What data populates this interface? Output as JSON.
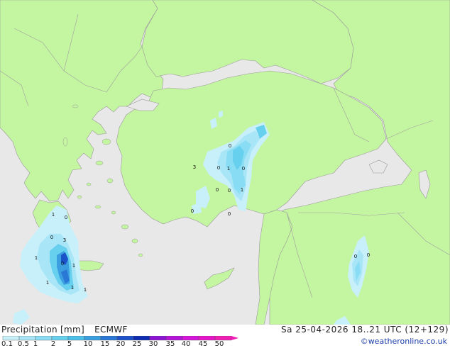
{
  "legend": {
    "title": "Precipitation [mm]",
    "model": "ECMWF",
    "timestamp": "Sa 25-04-2026 18..21 UTC (12+129)",
    "credit": "©weatheronline.co.uk",
    "scale_labels": [
      "0.1",
      "0.5",
      "1",
      "2",
      "5",
      "10",
      "15",
      "20",
      "25",
      "30",
      "35",
      "40",
      "45",
      "50"
    ],
    "scale_colors": [
      "#c8f0fa",
      "#a8e6f7",
      "#88dcf3",
      "#68d0ef",
      "#4cc0ea",
      "#3a9ee0",
      "#2a78d6",
      "#1c52c8",
      "#0e2cb0",
      "#8c14d2",
      "#b414d8",
      "#d414d8",
      "#e614c8",
      "#f01eb4"
    ]
  },
  "map": {
    "sea_color": "#e8e8e8",
    "land_color": "#c4f5a0",
    "border_color": "#a0a0a0",
    "coast_color": "#9a9a9a",
    "value_labels": [
      "1",
      "0",
      "0",
      "3",
      "1",
      "1",
      "0",
      "1",
      "1",
      "1",
      "0",
      "0",
      "1",
      "0",
      "0",
      "0",
      "1",
      "3",
      "0",
      "0",
      "0",
      "0"
    ]
  }
}
